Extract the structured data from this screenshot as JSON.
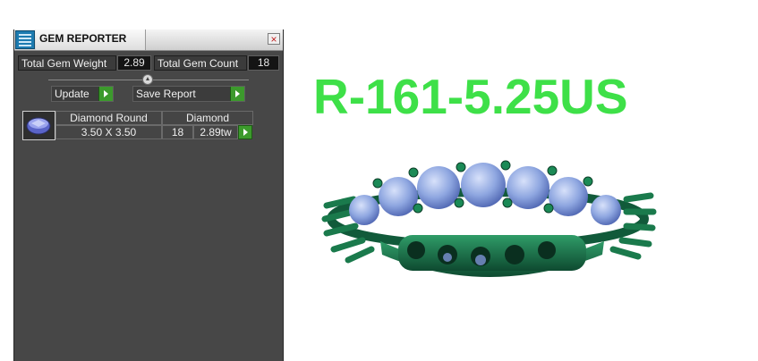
{
  "window": {
    "title": "GEM REPORTER",
    "close_glyph": "×"
  },
  "stats": {
    "weight_label": "Total Gem Weight",
    "weight_value": "2.89",
    "count_label": "Total Gem Count",
    "count_value": "18"
  },
  "buttons": {
    "update_label": "Update",
    "save_label": "Save Report"
  },
  "gem_table": {
    "headers": [
      "Diamond Round",
      "Diamond"
    ],
    "rows": [
      {
        "size": "3.50 X 3.50",
        "count": "18",
        "weight": "2.89tw"
      }
    ]
  },
  "model": {
    "name": "R-161-5.25US"
  },
  "colors": {
    "accent_green": "#3ee048",
    "ring_metal": "#1f7a52",
    "gem_blue": "#8ea6e0",
    "panel_bg": "#474747"
  },
  "icons": [
    "gem-reporter-app-icon",
    "close-icon",
    "arrow-right-icon",
    "slider-knob-icon",
    "round-gem-thumbnail"
  ]
}
